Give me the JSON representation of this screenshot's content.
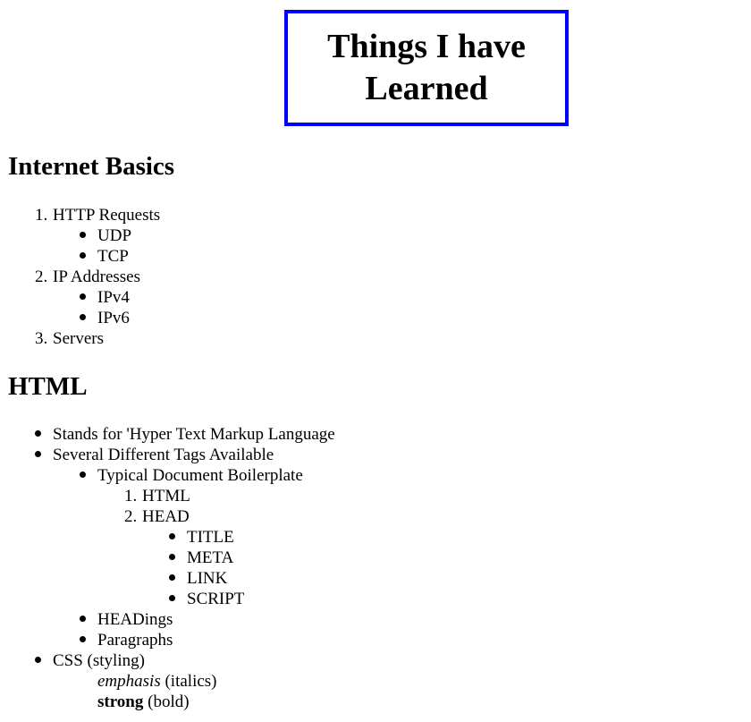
{
  "title": {
    "line1": "Things I have",
    "line2": "Learned"
  },
  "sections": {
    "internet_basics": {
      "heading": "Internet Basics",
      "items": [
        {
          "num": "1.",
          "label": "HTTP Requests",
          "children": [
            "UDP",
            "TCP"
          ]
        },
        {
          "num": "2.",
          "label": "IP Addresses",
          "children": [
            "IPv4",
            "IPv6"
          ]
        },
        {
          "num": "3.",
          "label": "Servers",
          "children": []
        }
      ]
    },
    "html": {
      "heading": "HTML",
      "items": [
        "Stands for 'Hyper Text Markup Language",
        "Several Different Tags Available"
      ],
      "tags": {
        "boilerplate": "Typical Document Boilerplate",
        "boilerplate_items": [
          {
            "num": "1.",
            "label": "HTML"
          },
          {
            "num": "2.",
            "label": "HEAD"
          }
        ],
        "head_children": [
          "TITLE",
          "META",
          "LINK",
          "SCRIPT"
        ],
        "others": [
          "HEADings",
          "Paragraphs"
        ]
      },
      "css": {
        "label": "CSS (styling)",
        "emphasis_word": "emphasis",
        "emphasis_note": "(italics)",
        "strong_word": "strong",
        "strong_note": "(bold)"
      }
    }
  }
}
